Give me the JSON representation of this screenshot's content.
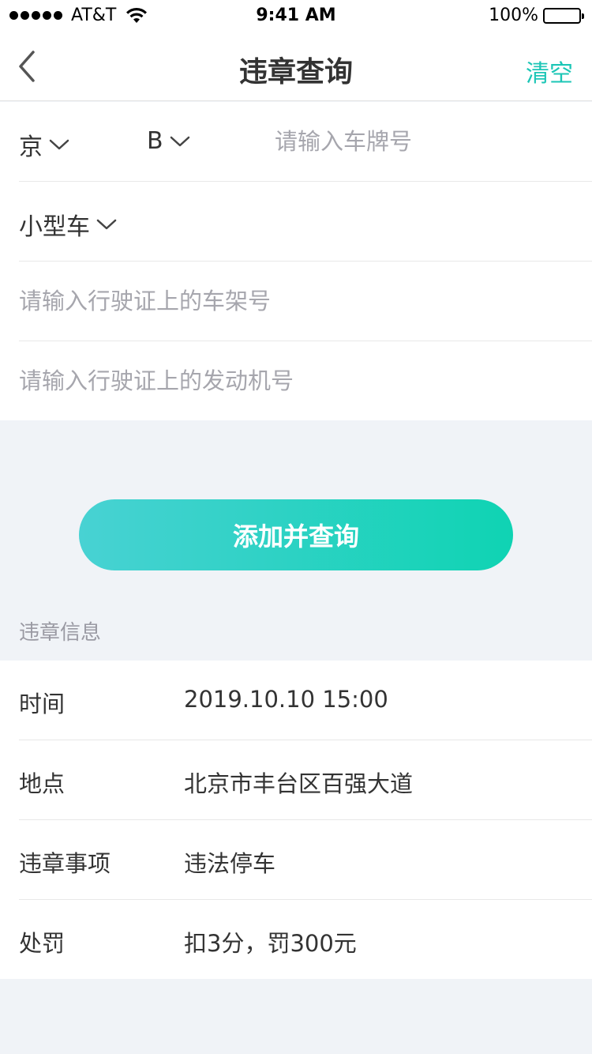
{
  "status_bar": {
    "carrier": "AT&T",
    "time": "9:41 AM",
    "battery": "100%",
    "icons": [
      "signal-dots-icon",
      "wifi-icon",
      "battery-icon"
    ]
  },
  "nav": {
    "back_icon": "chevron-left-icon",
    "title": "违章查询",
    "clear_label": "清空",
    "accent_color": "#1cc6b6"
  },
  "form": {
    "province": "京",
    "city_letter": "B",
    "plate_placeholder": "请输入车牌号",
    "vehicle_type": "小型车",
    "frame_placeholder": "请输入行驶证上的车架号",
    "engine_placeholder": "请输入行驶证上的发动机号",
    "dropdown_icon": "chevron-down-icon"
  },
  "submit": {
    "label": "添加并查询",
    "gradient": [
      "#48d2d3",
      "#0fd3b3"
    ]
  },
  "violation": {
    "section_title": "违章信息",
    "rows": [
      {
        "label": "时间",
        "value": "2019.10.10 15:00"
      },
      {
        "label": "地点",
        "value": "北京市丰台区百强大道"
      },
      {
        "label": "违章事项",
        "value": "违法停车"
      },
      {
        "label": "处罚",
        "value": "扣3分，罚300元"
      }
    ]
  }
}
